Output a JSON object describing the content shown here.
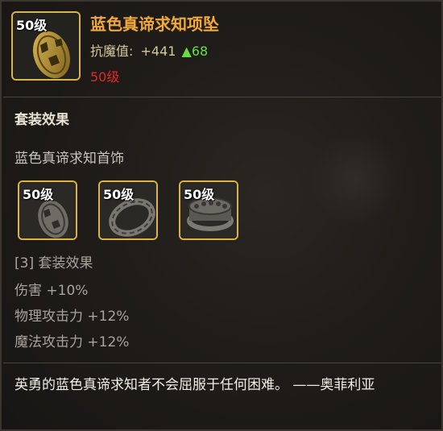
{
  "item": {
    "level_badge": "50级",
    "name": "蓝色真谛求知项坠",
    "stat_label": "抗魔值:",
    "stat_value": "+441",
    "stat_up": "▲68",
    "required_level": "50级"
  },
  "set": {
    "title": "套装效果",
    "set_name": "蓝色真谛求知首饰",
    "pieces": [
      {
        "level_badge": "50级",
        "icon": "pendant-icon"
      },
      {
        "level_badge": "50级",
        "icon": "bracelet-icon"
      },
      {
        "level_badge": "50级",
        "icon": "ring-icon"
      }
    ],
    "bonus_header": "[3] 套装效果",
    "bonuses": [
      "伤害 +10%",
      "物理攻击力 +12%",
      "魔法攻击力 +12%"
    ]
  },
  "flavor_text": "英勇的蓝色真谛求知者不会屈服于任何困难。 ——奥菲利亚",
  "colors": {
    "name": "#f0a93a",
    "stat": "#d4c89a",
    "up": "#64e040",
    "required": "#e02a2a",
    "slot_border": "#d8b44a"
  }
}
